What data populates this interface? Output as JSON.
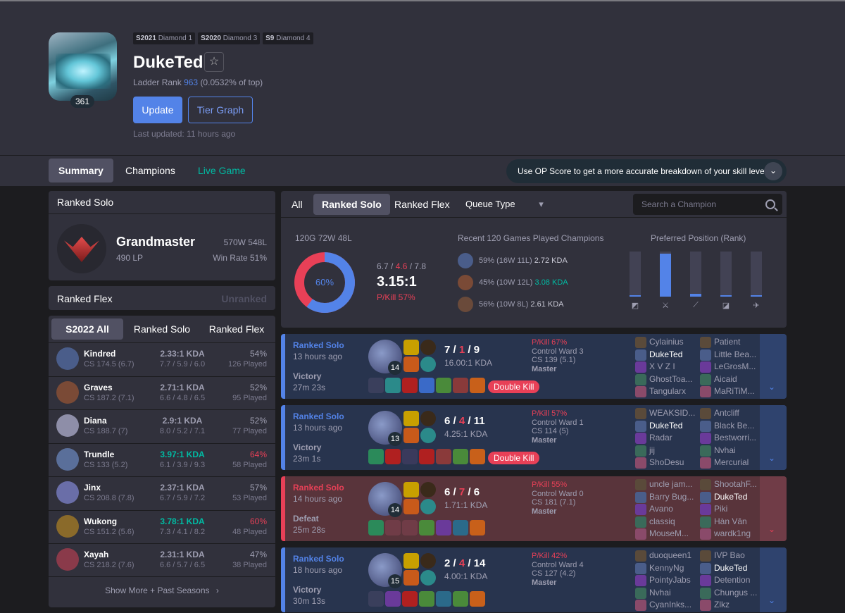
{
  "profile": {
    "seasons": [
      {
        "season": "S2021",
        "tier": "Diamond 1"
      },
      {
        "season": "S2020",
        "tier": "Diamond 3"
      },
      {
        "season": "S9",
        "tier": "Diamond 4"
      }
    ],
    "name": "DukeTed",
    "level": "361",
    "ladder_prefix": "Ladder Rank",
    "ladder_rank": "963",
    "ladder_suffix": "(0.0532% of top)",
    "update_label": "Update",
    "tier_graph_label": "Tier Graph",
    "last_updated": "Last updated: 11 hours ago"
  },
  "nav": {
    "tabs": [
      "Summary",
      "Champions",
      "Live Game"
    ],
    "opscore_text": "Use OP Score to get a more accurate breakdown of your skill level."
  },
  "ranked_solo": {
    "title": "Ranked Solo",
    "tier": "Grandmaster",
    "lp": "490 LP",
    "record": "570W 548L",
    "winrate": "Win Rate 51%"
  },
  "ranked_flex": {
    "title": "Ranked Flex",
    "status": "Unranked"
  },
  "champ_tabs": [
    "S2022 All",
    "Ranked Solo",
    "Ranked Flex"
  ],
  "champions": [
    {
      "name": "Kindred",
      "cs": "CS 174.5 (6.7)",
      "kda": "2.33:1 KDA",
      "avg": "7.7 / 5.9 / 6.0",
      "wr": "54%",
      "played": "126 Played",
      "kda_color": "",
      "wr_color": "",
      "color": "#4a5d8a"
    },
    {
      "name": "Graves",
      "cs": "CS 187.2 (7.1)",
      "kda": "2.71:1 KDA",
      "avg": "6.6 / 4.8 / 6.5",
      "wr": "52%",
      "played": "95 Played",
      "kda_color": "",
      "wr_color": "",
      "color": "#7a4a36"
    },
    {
      "name": "Diana",
      "cs": "CS 188.7 (7)",
      "kda": "2.9:1 KDA",
      "avg": "8.0 / 5.2 / 7.1",
      "wr": "52%",
      "played": "77 Played",
      "kda_color": "",
      "wr_color": "",
      "color": "#8e8ea8"
    },
    {
      "name": "Trundle",
      "cs": "CS 133 (5.2)",
      "kda": "3.97:1 KDA",
      "avg": "6.1 / 3.9 / 9.3",
      "wr": "64%",
      "played": "58 Played",
      "kda_color": "g",
      "wr_color": "r",
      "color": "#5a6f9a"
    },
    {
      "name": "Jinx",
      "cs": "CS 208.8 (7.8)",
      "kda": "2.37:1 KDA",
      "avg": "6.7 / 5.9 / 7.2",
      "wr": "57%",
      "played": "53 Played",
      "kda_color": "",
      "wr_color": "",
      "color": "#6a6ea8"
    },
    {
      "name": "Wukong",
      "cs": "CS 151.2 (5.6)",
      "kda": "3.78:1 KDA",
      "avg": "7.3 / 4.1 / 8.2",
      "wr": "60%",
      "played": "48 Played",
      "kda_color": "g",
      "wr_color": "r",
      "color": "#8a6a2a"
    },
    {
      "name": "Xayah",
      "cs": "CS 218.2 (7.6)",
      "kda": "2.31:1 KDA",
      "avg": "6.6 / 5.7 / 6.5",
      "wr": "47%",
      "played": "38 Played",
      "kda_color": "",
      "wr_color": "",
      "color": "#8a3a4a"
    }
  ],
  "show_more": "Show More + Past Seasons",
  "queue": {
    "tabs": [
      "All",
      "Ranked Solo",
      "Ranked Flex"
    ],
    "queue_type_label": "Queue Type",
    "search_placeholder": "Search a Champion"
  },
  "summary_stats": {
    "record": "120G 72W 48L",
    "winrate_pct": 60,
    "winrate_label": "60%",
    "kills": "6.7",
    "deaths": "4.6",
    "assists": "7.8",
    "kda": "3.15:1",
    "pkill": "P/Kill 57%",
    "recent_title": "Recent 120 Games Played Champions",
    "recent": [
      {
        "wr": "59%",
        "record": "(16W 11L)",
        "kda": "2.72 KDA",
        "color": "#4a5d8a"
      },
      {
        "wr": "45%",
        "record": "(10W 12L)",
        "kda": "3.08 KDA",
        "color": "#7a4a36"
      },
      {
        "wr": "56%",
        "record": "(10W 8L)",
        "kda": "2.61 KDA",
        "color": "#6a4a3a"
      }
    ],
    "position_title": "Preferred Position (Rank)",
    "positions": [
      {
        "name": "top",
        "value": 0.02
      },
      {
        "name": "jungle",
        "value": 0.95
      },
      {
        "name": "mid",
        "value": 0.06
      },
      {
        "name": "adc",
        "value": 0.01
      },
      {
        "name": "support",
        "value": 0.03
      }
    ]
  },
  "matches": [
    {
      "result_class": "win",
      "queue": "Ranked Solo",
      "ago": "13 hours ago",
      "result": "Victory",
      "length": "27m 23s",
      "champ_level": "14",
      "k": "7",
      "d": "1",
      "a": "9",
      "ratio": "16.00:1 KDA",
      "pkill": "P/Kill 67%",
      "ward": "Control Ward 3",
      "cs": "CS 139 (5.1)",
      "tier": "Master",
      "badge": "Double Kill",
      "items": [
        "#3a3f5c",
        "#2b8a8a",
        "#b02020",
        "#3a6ac8",
        "#4a8a3a",
        "#8a3a3a",
        "#c8601a"
      ],
      "team1": [
        "Cylainius",
        "DukeTed",
        "X V Z I",
        "GhostToa...",
        "Tangularx"
      ],
      "team2": [
        "Patient",
        "Little Bea...",
        "LeGrosM...",
        "Aicaid",
        "MaRiTiM..."
      ],
      "me_team": 1,
      "me_index": 1
    },
    {
      "result_class": "win",
      "queue": "Ranked Solo",
      "ago": "13 hours ago",
      "result": "Victory",
      "length": "23m 1s",
      "champ_level": "13",
      "k": "6",
      "d": "4",
      "a": "11",
      "ratio": "4.25:1 KDA",
      "pkill": "P/Kill 57%",
      "ward": "Control Ward 1",
      "cs": "CS 114 (5)",
      "tier": "Master",
      "badge": "Double Kill",
      "items": [
        "#2b8a5a",
        "#b02020",
        "#3a3a5c",
        "#b02020",
        "#8a3a3a",
        "#4a8a3a",
        "#c8601a"
      ],
      "team1": [
        "WEAKSID...",
        "DukeTed",
        "Radar",
        "jij",
        "ShoDesu"
      ],
      "team2": [
        "Antcliff",
        "Black Be...",
        "Bestworri...",
        "Nvhai",
        "Mercurial"
      ],
      "me_team": 1,
      "me_index": 1
    },
    {
      "result_class": "loss",
      "queue": "Ranked Solo",
      "ago": "14 hours ago",
      "result": "Defeat",
      "length": "25m 28s",
      "champ_level": "14",
      "k": "6",
      "d": "7",
      "a": "6",
      "ratio": "1.71:1 KDA",
      "pkill": "P/Kill 55%",
      "ward": "Control Ward 0",
      "cs": "CS 181 (7.1)",
      "tier": "Master",
      "badge": "",
      "items": [
        "#2b8a5a",
        "#703c47",
        "#703c47",
        "#4a8a3a",
        "#6a3a9a",
        "#2b6a8a",
        "#c8601a"
      ],
      "team1": [
        "uncle jam...",
        "Barry Bug...",
        "Avano",
        "classiq",
        "MouseM..."
      ],
      "team2": [
        "ShootahF...",
        "DukeTed",
        "Piki",
        "Hàn Vân",
        "wardk1ng"
      ],
      "me_team": 2,
      "me_index": 1
    },
    {
      "result_class": "win",
      "queue": "Ranked Solo",
      "ago": "18 hours ago",
      "result": "Victory",
      "length": "30m 13s",
      "champ_level": "15",
      "k": "2",
      "d": "4",
      "a": "14",
      "ratio": "4.00:1 KDA",
      "pkill": "P/Kill 42%",
      "ward": "Control Ward 4",
      "cs": "CS 127 (4.2)",
      "tier": "Master",
      "badge": "",
      "items": [
        "#3a3f5c",
        "#6a3a9a",
        "#b02020",
        "#4a8a3a",
        "#2b6a8a",
        "#4a8a3a",
        "#c8601a"
      ],
      "team1": [
        "duoqueen1",
        "KennyNg",
        "PointyJabs",
        "Nvhai",
        "CyanInks..."
      ],
      "team2": [
        "IVP Bao",
        "DukeTed",
        "Detention",
        "Chungus ...",
        "Zlkz"
      ],
      "me_team": 2,
      "me_index": 1
    }
  ]
}
